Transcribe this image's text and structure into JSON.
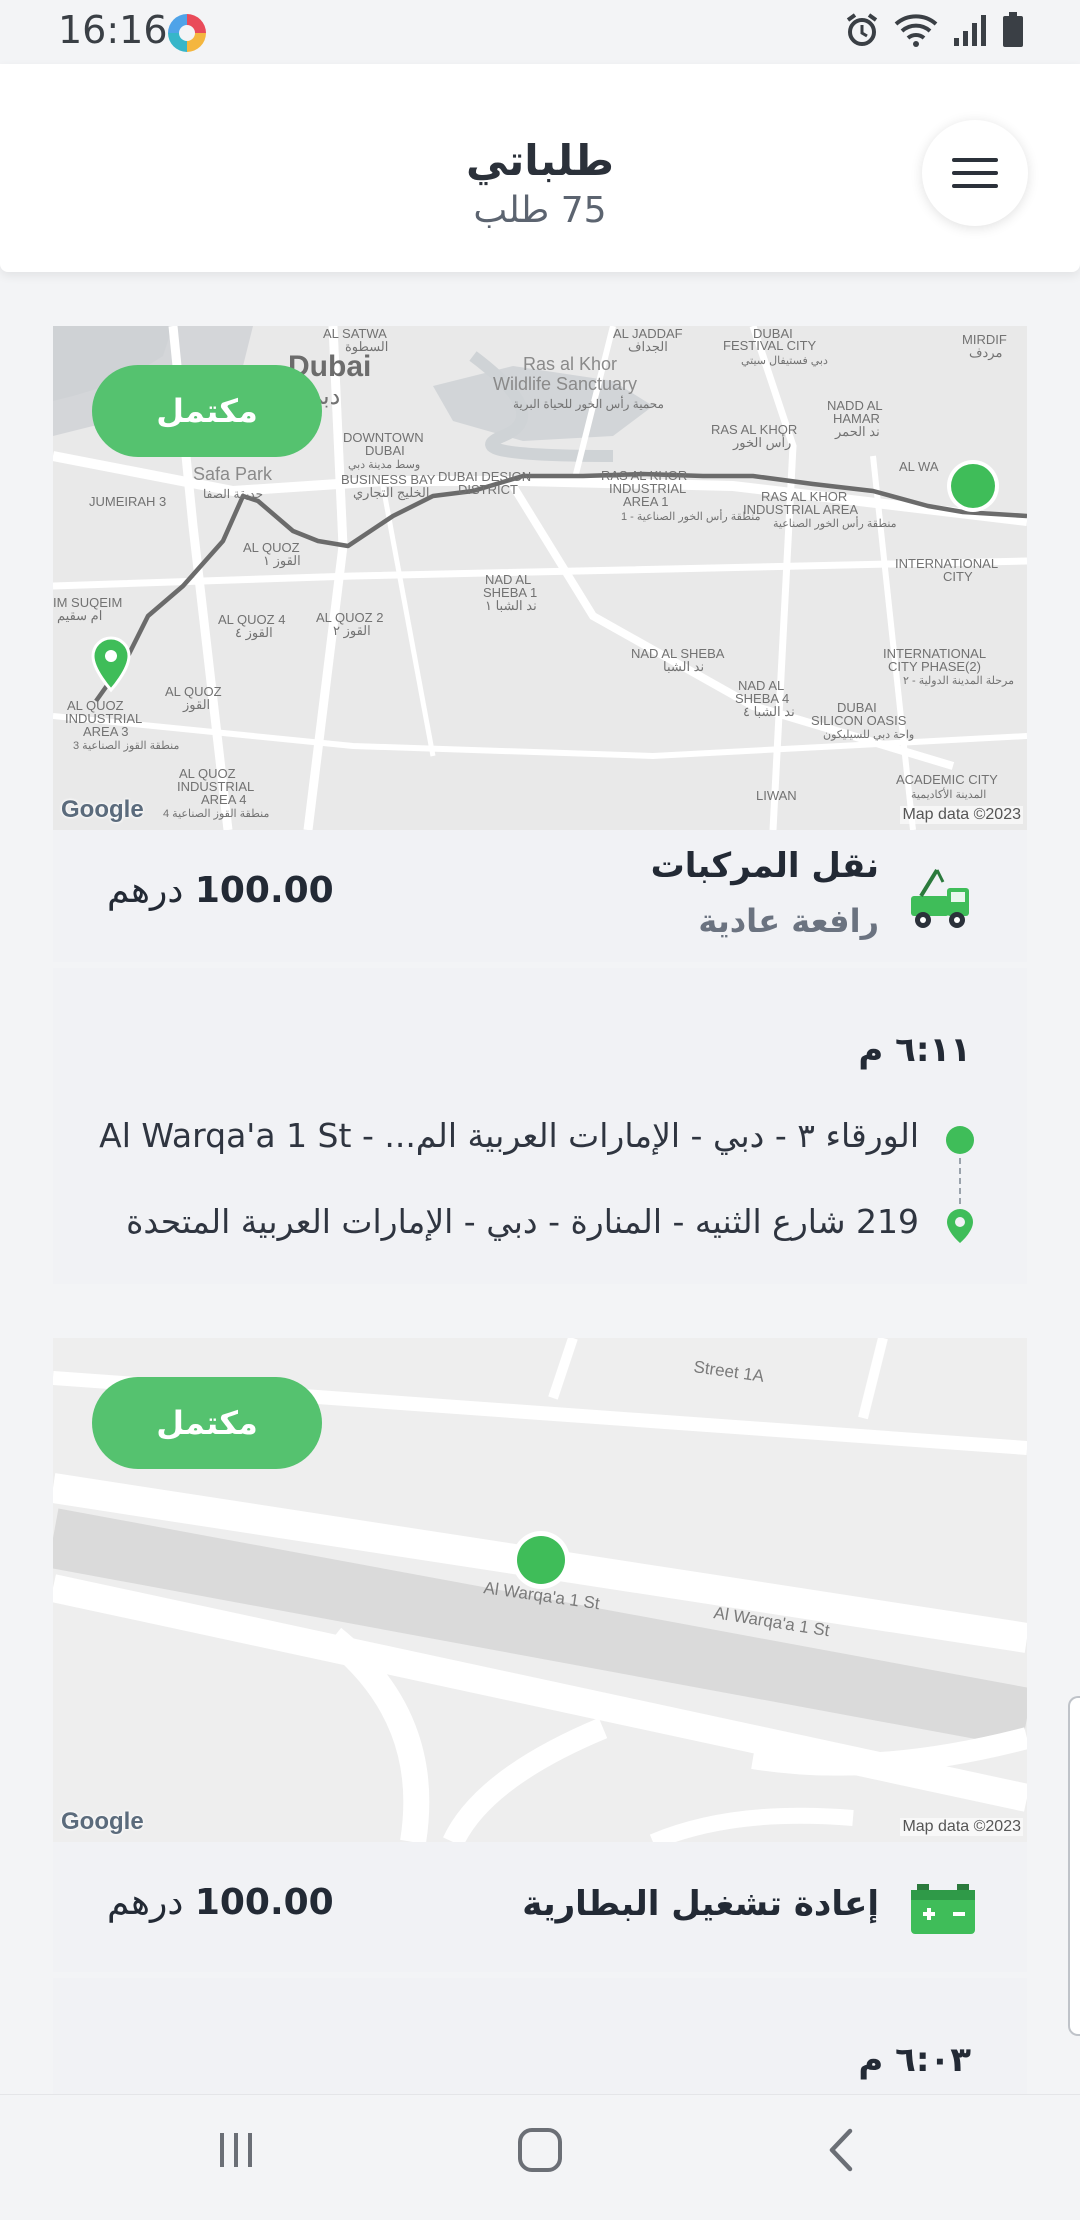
{
  "status_bar": {
    "time": "16:16"
  },
  "header": {
    "title": "طلباتي",
    "subtitle": "75 طلب"
  },
  "colors": {
    "accent_green": "#55c26f",
    "dot_green": "#3fbd59",
    "text_dark": "#232a35"
  },
  "orders": [
    {
      "status": "مكتمل",
      "service_title": "نقل المركبات",
      "service_subtitle": "رافعة عادية",
      "service_icon": "tow-truck-icon",
      "price": "100.00",
      "currency": "درهم",
      "time": "٦:١١ م",
      "pickup": "الورقاء ٣ - دبي - الإمارات العربية الم... - Al Warqa'a 1 St",
      "dropoff": "219 شارع الثنيه - المنارة - دبي - الإمارات العربية المتحدة",
      "map": {
        "google": "Google",
        "attribution": "Map data ©2023",
        "labels": {
          "satwa": "AL SATWA",
          "satwa_ar": "السطوة",
          "jaddaf": "AL JADDAF",
          "jaddaf_ar": "الجداف",
          "festival": "DUBAI",
          "festival2": "FESTIVAL CITY",
          "festival_ar": "دبي فستيفال سيتي",
          "mirdif": "MIRDIF",
          "mirdif_ar": "مردف",
          "dubai": "Dubai",
          "dubai_ar": "دبي",
          "raskhor_ws": "Ras al Khor",
          "raskhor_ws2": "Wildlife Sanctuary",
          "raskhor_ws_ar": "محمية رأس الخور للحياة البرية",
          "nadd_hamar": "NADD AL",
          "nadd_hamar2": "HAMAR",
          "nadd_hamar_ar": "ند الحمر",
          "raskhor": "RAS AL KHOR",
          "raskhor_ar": "رأس الخور",
          "downtown": "DOWNTOWN",
          "downtown2": "DUBAI",
          "downtown_ar": "وسط مدينة دبي",
          "business_bay": "BUSINESS BAY",
          "business_bay_ar": "الخليج التجاري",
          "design": "DUBAI DESIGN",
          "design2": "DISTRICT",
          "rk_ind1": "RAS AL KHOR",
          "rk_ind1b": "INDUSTRIAL",
          "rk_ind1c": "AREA 1",
          "rk_ind1_ar": "منطقة رأس الخور الصناعية - 1",
          "rk_ind2": "RAS AL KHOR",
          "rk_ind2b": "INDUSTRIAL AREA",
          "rk_ind2_ar": "منطقة رأس الخور الصناعية",
          "safa": "Safa Park",
          "safa_ar": "حديقة الصفا",
          "jumeirah": "JUMEIRAH 3",
          "quoz1": "AL QUOZ",
          "quoz1b": "1",
          "quoz1_ar": "القوز ١",
          "nadsheba1": "NAD AL",
          "nadsheba1b": "SHEBA 1",
          "nadsheba1_ar": "ند الشبا ١",
          "intl_city": "INTERNATIONAL",
          "intl_city2": "CITY",
          "suqeim": "IM SUQEIM",
          "suqeim_ar": "ام سقيم",
          "quoz4": "AL QUOZ 4",
          "quoz4_ar": "القوز ٤",
          "quoz2": "AL QUOZ 2",
          "quoz2_ar": "القوز ٢",
          "nadsheba": "NAD AL SHEBA",
          "nadsheba_ar": "ند الشبا",
          "intl2": "INTERNATIONAL",
          "intl2b": "CITY PHASE(2)",
          "intl2_ar": "مرحلة المدينة الدولية - ٢",
          "quoz_ind3": "AL QUOZ",
          "quoz_ind3b": "INDUSTRIAL",
          "quoz_ind3c": "AREA 3",
          "quoz_ind3_ar": "منطقة القوز الصناعية 3",
          "quoz": "AL QUOZ",
          "quoz_ar": "القوز",
          "nadsheba4": "NAD AL",
          "nadsheba4b": "SHEBA 4",
          "nadsheba4_ar": "ند الشبا ٤",
          "silicon": "DUBAI",
          "silicon2": "SILICON OASIS",
          "silicon_ar": "واحة دبي للسيليكون",
          "quoz_ind4": "AL QUOZ",
          "quoz_ind4b": "INDUSTRIAL",
          "quoz_ind4c": "AREA 4",
          "quoz_ind4_ar": "منطقة القوز الصناعية 4",
          "academic": "ACADEMIC CITY",
          "academic_ar": "المدينة الأكاديمية",
          "liwan": "LIWAN",
          "alwa": "AL WA"
        }
      }
    },
    {
      "status": "مكتمل",
      "service_title": "إعادة تشغيل البطارية",
      "service_icon": "car-battery-icon",
      "price": "100.00",
      "currency": "درهم",
      "time": "٦:٠٣ م",
      "map": {
        "google": "Google",
        "attribution": "Map data ©2023",
        "labels": {
          "street1a": "Street 1A",
          "warqa1": "Al Warqa'a 1 St",
          "warqa2": "Al Warqa'a 1 St"
        }
      }
    }
  ]
}
